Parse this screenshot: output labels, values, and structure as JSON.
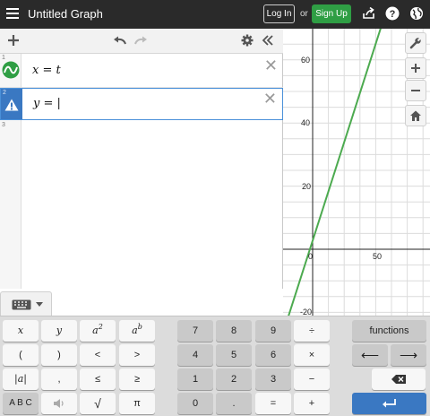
{
  "header": {
    "title": "Untitled Graph",
    "login_label": "Log In",
    "or_text": "or",
    "signup_label": "Sign Up"
  },
  "expression_list": {
    "rows": [
      {
        "number": "1",
        "expression": "x = t",
        "status_icon": "slider-wave-icon"
      },
      {
        "number": "2",
        "expression": "y = |",
        "status_icon": "warning-icon"
      },
      {
        "number": "3",
        "expression": ""
      }
    ]
  },
  "graph": {
    "y_ticks": [
      "60",
      "40",
      "20",
      "-20"
    ],
    "x_ticks": [
      "0",
      "50"
    ],
    "line_color": "#4caa4f"
  },
  "keypad": {
    "toggle_icon": "keyboard-icon",
    "keys": {
      "x": "x",
      "y": "y",
      "a2": "a",
      "ab": "a",
      "sup2": "2",
      "supb": "b",
      "lparen": "(",
      "rparen": ")",
      "lt": "<",
      "gt": ">",
      "abs": "|a|",
      "comma": ",",
      "le": "≤",
      "ge": "≥",
      "abc": "A B C",
      "sqrt": "√",
      "pi": "π",
      "k7": "7",
      "k8": "8",
      "k9": "9",
      "div": "÷",
      "k4": "4",
      "k5": "5",
      "k6": "6",
      "mul": "×",
      "k1": "1",
      "k2": "2",
      "k3": "3",
      "minus": "−",
      "k0": "0",
      "dot": ".",
      "eq": "=",
      "plus": "+",
      "functions": "functions",
      "left": "⟵",
      "right": "⟶"
    }
  }
}
